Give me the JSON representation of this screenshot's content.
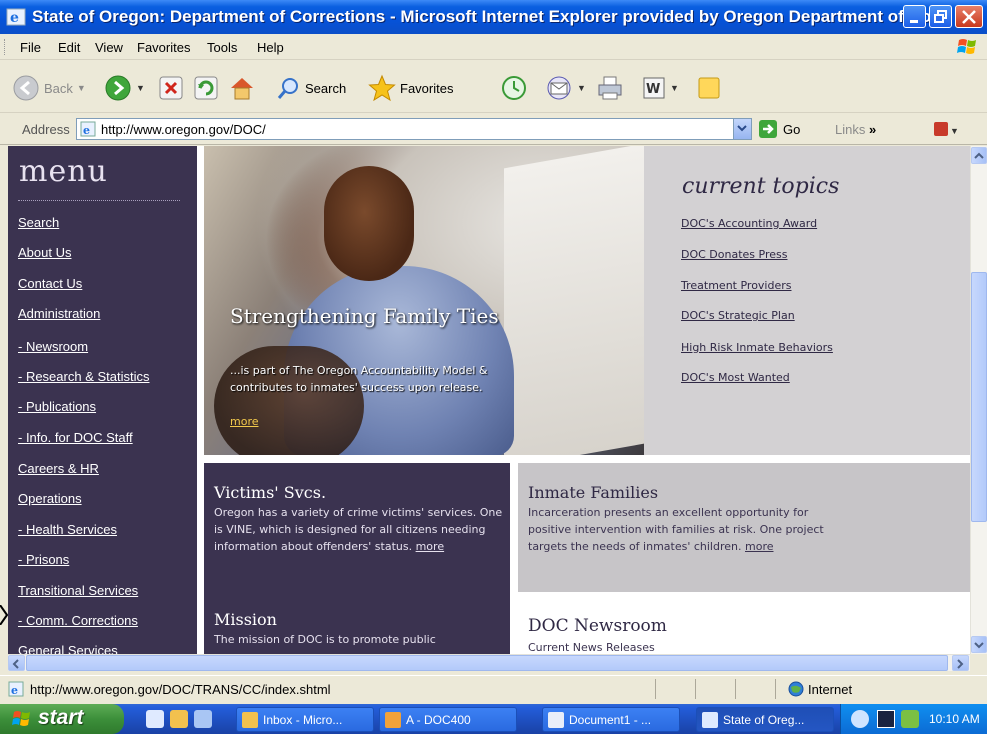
{
  "window": {
    "title": "State of Oregon: Department of Corrections - Microsoft Internet Explorer provided by Oregon Department of Cor...",
    "icon": "ie-icon",
    "controls": [
      "minimize-icon",
      "maximize-icon",
      "close-icon"
    ]
  },
  "menubar": {
    "items": [
      "File",
      "Edit",
      "View",
      "Favorites",
      "Tools",
      "Help"
    ]
  },
  "toolbar": {
    "back_label": "Back",
    "search_label": "Search",
    "favorites_label": "Favorites"
  },
  "address": {
    "label": "Address",
    "url": "http://www.oregon.gov/DOC/",
    "go_label": "Go",
    "links_label": "Links"
  },
  "page": {
    "menu": {
      "title": "menu",
      "items": [
        "Search",
        "About Us",
        "Contact Us",
        "Administration",
        "- Newsroom",
        "- Research & Statistics",
        "- Publications",
        "- Info. for DOC Staff",
        "Careers & HR",
        "Operations",
        "- Health Services",
        "- Prisons",
        "Transitional Services",
        "- Comm. Corrections",
        "General Services"
      ]
    },
    "hero": {
      "title": "Strengthening Family Ties",
      "description": "...is part of The Oregon Accountability Model & contributes to inmates' success upon release.",
      "more": "more"
    },
    "topics": {
      "title": "current topics",
      "links": [
        "DOC's Accounting Award",
        "DOC Donates Press",
        "Treatment Providers",
        "DOC's Strategic Plan",
        "High Risk Inmate Behaviors",
        "DOC's Most Wanted"
      ]
    },
    "victims": {
      "heading": "Victims' Svcs.",
      "text": "Oregon has a variety of crime victims' services. One is VINE, which is designed for all citizens needing information about offenders' status.",
      "more": "more"
    },
    "mission": {
      "heading": "Mission",
      "text": "The mission of DOC is to promote public"
    },
    "inmate_families": {
      "heading": "Inmate Families",
      "text": "Incarceration presents an excellent opportunity for positive intervention with families at risk. One project targets the needs of inmates' children.",
      "more": "more"
    },
    "newsroom": {
      "heading": "DOC Newsroom",
      "text": "Current News Releases"
    }
  },
  "statusbar": {
    "text": "http://www.oregon.gov/DOC/TRANS/CC/index.shtml",
    "zone": "Internet"
  },
  "taskbar": {
    "start_label": "start",
    "tasks": [
      "Inbox - Micro...",
      "A - DOC400",
      "Document1 - ...",
      "State of Oreg..."
    ],
    "clock": "10:10 AM"
  },
  "colors": {
    "menu_bg": "#3b3350",
    "topics_bg": "#d3d1d3",
    "inmate_bg": "#c7c5c8",
    "hero_more": "#f2c94c",
    "titlebar": "#0652d8",
    "start_green": "#3c8f3a"
  }
}
